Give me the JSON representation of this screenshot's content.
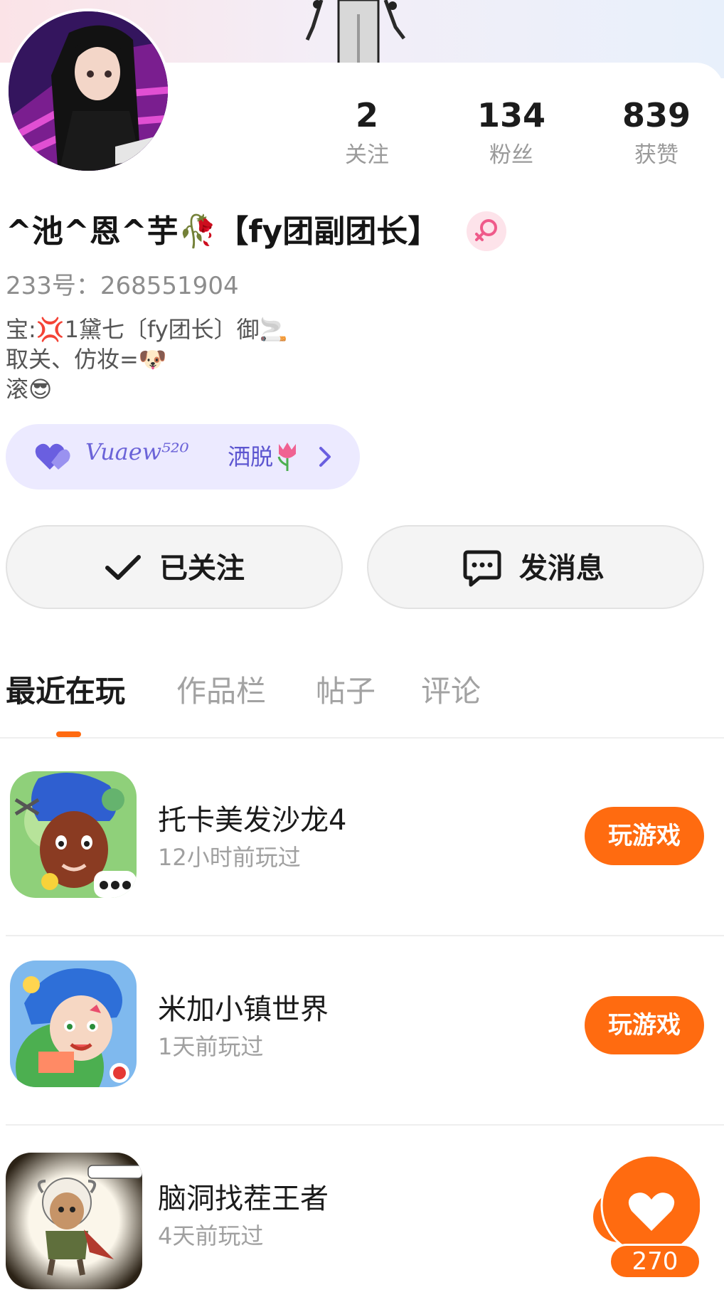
{
  "profile": {
    "nickname": "^池^恩^芋🥀【fy团副团长】",
    "uid_text": "233号：268551904",
    "bio_lines": [
      "宝:💢1黛七〔fy团长〕御🚬",
      "取关、仿妆=🐶",
      "滚😎"
    ],
    "stats": [
      {
        "value": "2",
        "label": "关注"
      },
      {
        "value": "134",
        "label": "粉丝"
      },
      {
        "value": "839",
        "label": "获赞"
      }
    ],
    "gender_icon": "female-symbol-icon"
  },
  "couple_badge": {
    "signature": "Vuaew⁵²⁰",
    "text": "洒脱"
  },
  "actions": {
    "follow_label": "已关注",
    "message_label": "发消息"
  },
  "tabs": [
    "最近在玩",
    "作品栏",
    "帖子",
    "评论"
  ],
  "active_tab": "最近在玩",
  "games": [
    {
      "name": "托卡美发沙龙4",
      "last_played": "12小时前玩过",
      "button": "玩游戏"
    },
    {
      "name": "米加小镇世界",
      "last_played": "1天前玩过",
      "button": "玩游戏"
    },
    {
      "name": "脑洞找茬王者",
      "last_played": "4天前玩过"
    }
  ],
  "like_fab": {
    "count": "270"
  },
  "colors": {
    "accent": "#ff6b10",
    "chip_bg": "#eceaff",
    "chip_text": "#5c55d0"
  }
}
